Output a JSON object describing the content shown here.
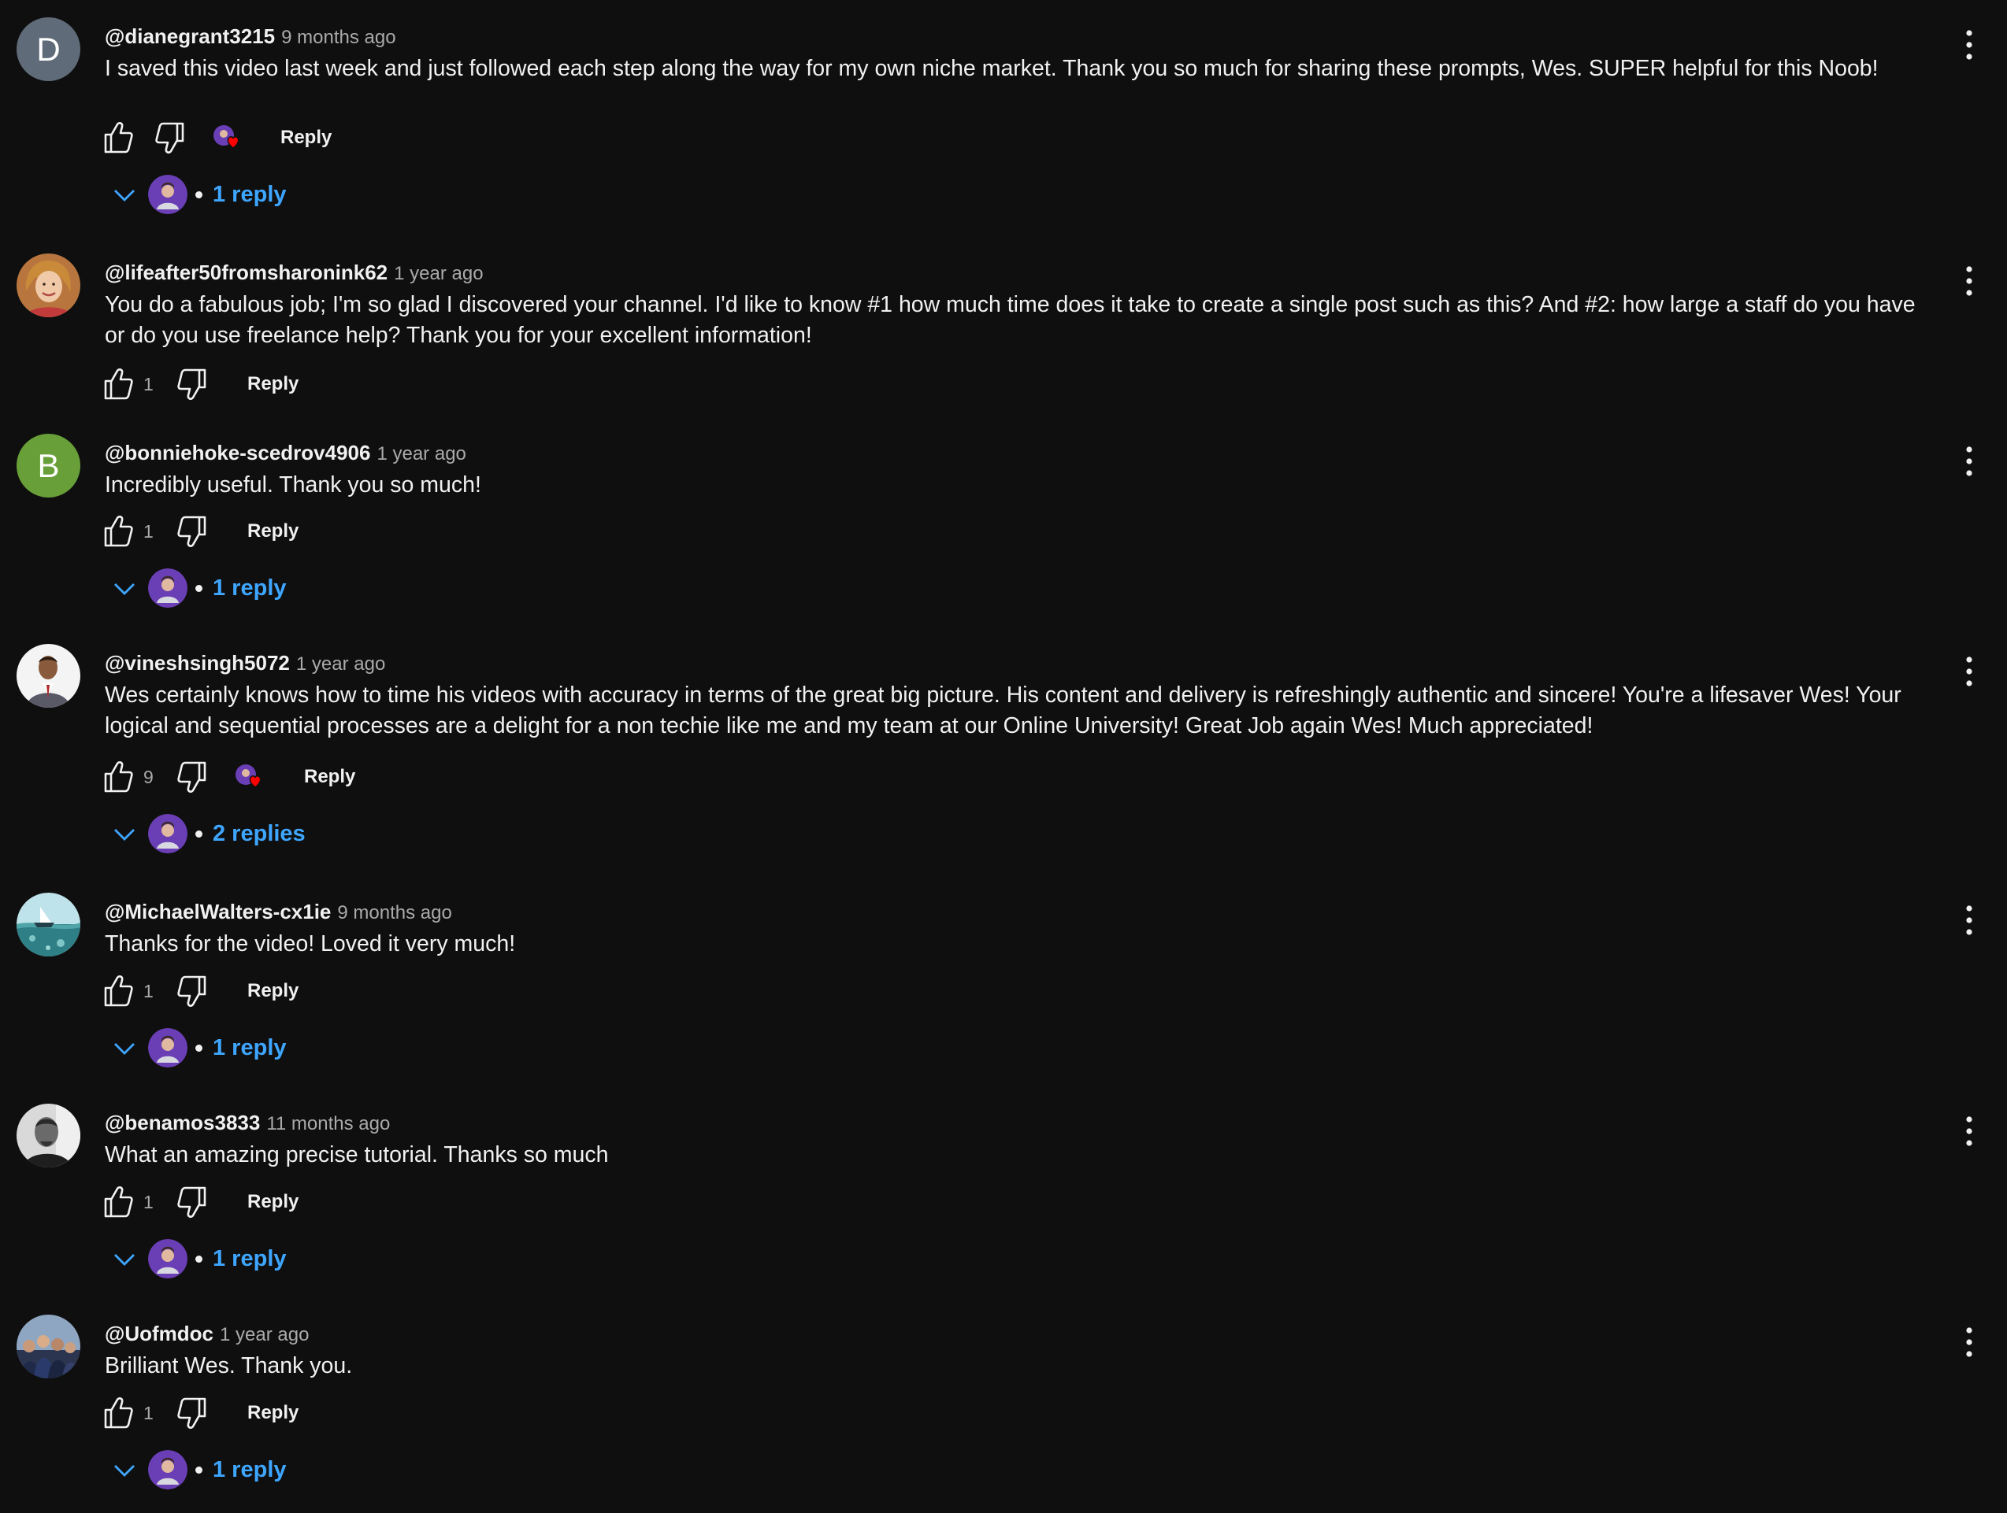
{
  "colors": {
    "background": "#0f0f0f",
    "text": "#f1f1f1",
    "secondary": "#aaaaaa",
    "link": "#3ea6ff",
    "heart": "#ff0000"
  },
  "reply_label": "Reply",
  "comments": [
    {
      "author": "@dianegrant3215",
      "time": "9 months ago",
      "text": "I saved this video last week and just followed each step along the way for my own niche market. Thank you so much for sharing these prompts, Wes. SUPER helpful for this Noob!",
      "likes": "",
      "hearted": true,
      "replies": "1 reply",
      "avatar": {
        "type": "letter",
        "letter": "D",
        "color": "#5f6b78"
      }
    },
    {
      "author": "@lifeafter50fromsharonink62",
      "time": "1 year ago",
      "text": "You do a fabulous job; I'm so glad I discovered your channel. I'd like to know #1 how much time does it take to create a single post such as this? And #2: how large a staff do you have or do you use freelance help? Thank you for your excellent information!",
      "likes": "1",
      "hearted": false,
      "replies": "",
      "avatar": {
        "type": "photo",
        "icon": "woman-portrait-avatar"
      }
    },
    {
      "author": "@bonniehoke-scedrov4906",
      "time": "1 year ago",
      "text": "Incredibly useful. Thank you so much!",
      "likes": "1",
      "hearted": false,
      "replies": "1 reply",
      "avatar": {
        "type": "letter",
        "letter": "B",
        "color": "#689f38"
      }
    },
    {
      "author": "@vineshsingh5072",
      "time": "1 year ago",
      "text": "Wes certainly knows how to time his videos with accuracy in terms of the great big picture. His content and delivery is refreshingly authentic and sincere! You're a lifesaver Wes! Your logical and sequential processes are a delight for a non techie like me and my team at our Online University! Great Job again Wes! Much appreciated!",
      "likes": "9",
      "hearted": true,
      "replies": "2 replies",
      "avatar": {
        "type": "photo",
        "icon": "man-suit-avatar"
      }
    },
    {
      "author": "@MichaelWalters-cx1ie",
      "time": "9 months ago",
      "text": "Thanks for the video! Loved it very much!",
      "likes": "1",
      "hearted": false,
      "replies": "1 reply",
      "avatar": {
        "type": "photo",
        "icon": "ocean-boat-avatar"
      }
    },
    {
      "author": "@benamos3833",
      "time": "11 months ago",
      "text": "What an amazing precise tutorial. Thanks so much",
      "likes": "1",
      "hearted": false,
      "replies": "1 reply",
      "avatar": {
        "type": "photo",
        "icon": "man-bw-portrait-avatar"
      }
    },
    {
      "author": "@Uofmdoc",
      "time": "1 year ago",
      "text": "Brilliant Wes. Thank you.",
      "likes": "1",
      "hearted": false,
      "replies": "1 reply",
      "avatar": {
        "type": "photo",
        "icon": "group-photo-avatar"
      }
    }
  ]
}
